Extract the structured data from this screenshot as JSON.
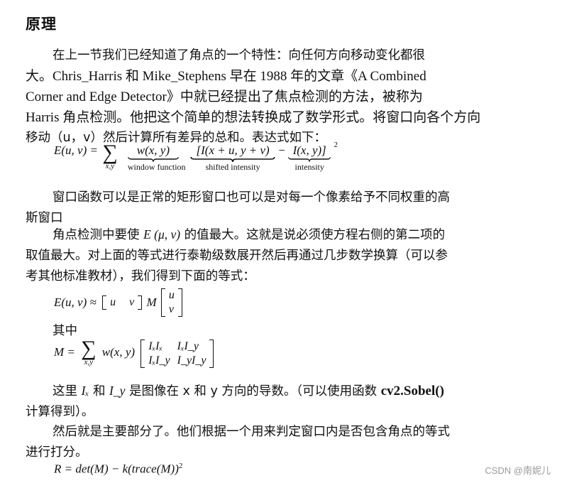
{
  "heading": "原理",
  "para1": {
    "line1": "在上一节我们已经知道了角点的一个特性：向任何方向移动变化都很",
    "line2": "大。Chris_Harris 和 Mike_Stephens 早在 1988 年的文章《A Combined",
    "line3": "Corner and Edge Detector》中就已经提出了焦点检测的方法，被称为",
    "line4": "Harris 角点检测。他把这个简单的想法转换成了数学形式。将窗口向各个方向",
    "line5": "移动（u，v）然后计算所有差异的总和。表达式如下："
  },
  "equation1": {
    "lhs": "E(u, v) =",
    "sum_sub": "x,y",
    "term1": "w(x, y)",
    "term1_label": "window function",
    "term2": "[I(x + u, y + v)",
    "term2_label": "shifted intensity",
    "minus": "−",
    "term3": "I(x, y)]",
    "term3_label": "intensity",
    "exponent": "2"
  },
  "para2": {
    "line1": "窗口函数可以是正常的矩形窗口也可以是对每一个像素给予不同权重的高",
    "line2": "斯窗口"
  },
  "para3": {
    "line1_pre": "角点检测中要使 ",
    "line1_math": "E (μ, ν)",
    "line1_post": " 的值最大。这就是说必须使方程右侧的第二项的",
    "line2": "取值最大。对上面的等式进行泰勒级数展开然后再通过几步数学换算（可以参",
    "line3": "考其他标准教材），我们得到下面的等式："
  },
  "equation2": {
    "lhs": "E(u, v) ≈",
    "row_vector": [
      "u",
      "v"
    ],
    "matrix_name": "M",
    "col_vector": [
      "u",
      "v"
    ]
  },
  "among_label": "其中",
  "equation3": {
    "lhs": "M =",
    "sum_sub": "x,y",
    "weight": "w(x, y)",
    "matrix": [
      [
        "IₓIₓ",
        "IₓI_y"
      ],
      [
        "IₓI_y",
        "I_yI_y"
      ]
    ]
  },
  "para4": {
    "pre": "这里 ",
    "ix": "Iₓ",
    "and": " 和 ",
    "iy": "I_y",
    "mid": " 是图像在 x 和 y 方向的导数。（可以使用函数 ",
    "func": "cv2.Sobel()",
    "line2": "计算得到）。"
  },
  "para5": {
    "line1": "然后就是主要部分了。他们根据一个用来判定窗口内是否包含角点的等式",
    "line2": "进行打分。"
  },
  "equation4": {
    "text": "R = det(M) − k(trace(M))",
    "exponent": "2"
  },
  "watermark": "CSDN @南妮儿"
}
